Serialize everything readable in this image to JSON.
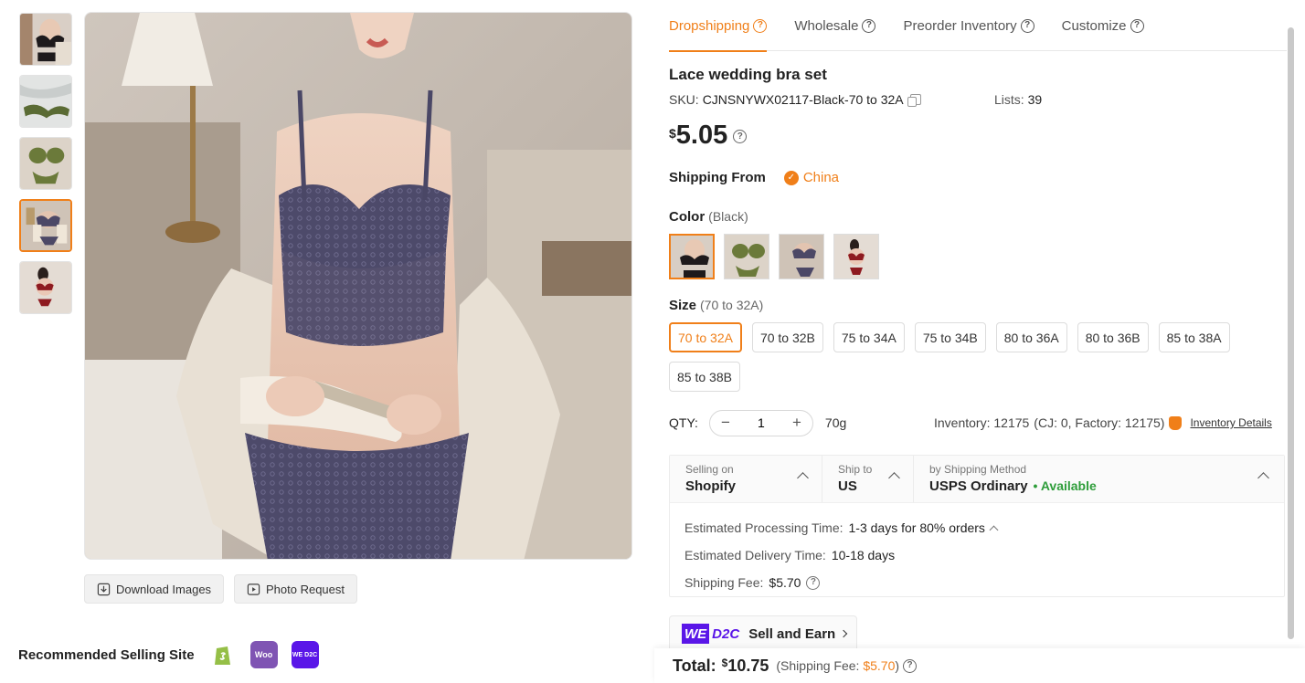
{
  "thumbnails": [
    {
      "name": "thumb-black-set"
    },
    {
      "name": "thumb-green-flatlay"
    },
    {
      "name": "thumb-green-set"
    },
    {
      "name": "thumb-blue-set"
    },
    {
      "name": "thumb-red-set"
    }
  ],
  "image_actions": {
    "download": "Download Images",
    "photo_request": "Photo Request"
  },
  "recommended": {
    "title": "Recommended Selling Site",
    "sites": [
      "shopify-icon",
      "woocommerce-icon",
      "wed2c-icon"
    ],
    "woo_text": "Woo",
    "wed2c_text": "WE D2C"
  },
  "tabs": [
    {
      "label": "Dropshipping",
      "active": true
    },
    {
      "label": "Wholesale",
      "active": false
    },
    {
      "label": "Preorder Inventory",
      "active": false
    },
    {
      "label": "Customize",
      "active": false
    }
  ],
  "product": {
    "title": "Lace wedding bra set",
    "sku_label": "SKU:",
    "sku": "CJNSNYWX02117-Black-70 to 32A",
    "lists_label": "Lists:",
    "lists": "39",
    "currency": "$",
    "price": "5.05"
  },
  "shipping_from": {
    "label": "Shipping From",
    "country": "China"
  },
  "color": {
    "label": "Color",
    "selected": "(Black)",
    "options": [
      "Black",
      "Green",
      "Blue",
      "Red"
    ]
  },
  "size": {
    "label": "Size",
    "selected": "(70 to 32A)",
    "options": [
      "70 to 32A",
      "70 to 32B",
      "75 to 34A",
      "75 to 34B",
      "80 to 36A",
      "80 to 36B",
      "85 to 38A",
      "85 to 38B"
    ]
  },
  "qty": {
    "label": "QTY:",
    "value": "1",
    "weight": "70g",
    "minus": "−",
    "plus": "+"
  },
  "inventory": {
    "text": "Inventory: 12175",
    "detail": "(CJ: 0, Factory: 12175)",
    "link": "Inventory Details"
  },
  "shipping": {
    "selling_on_label": "Selling on",
    "selling_on": "Shopify",
    "ship_to_label": "Ship to",
    "ship_to": "US",
    "method_label": "by Shipping Method",
    "method": "USPS Ordinary",
    "availability": "• Available",
    "processing_label": "Estimated Processing Time:",
    "processing": "1-3 days for 80% orders",
    "delivery_label": "Estimated Delivery Time:",
    "delivery": "10-18 days",
    "fee_label": "Shipping Fee:",
    "fee": "$5.70"
  },
  "d2c": {
    "we": "WE",
    "d2c": "D2C",
    "cta": "Sell and Earn"
  },
  "total": {
    "label": "Total:",
    "currency": "$",
    "value": "10.75",
    "fee_prefix": "(Shipping Fee:",
    "fee": "$5.70",
    "fee_suffix": ")"
  },
  "colors": {
    "accent": "#f07f19",
    "available": "#2e9d3a",
    "wed2c": "#5a16e8"
  }
}
